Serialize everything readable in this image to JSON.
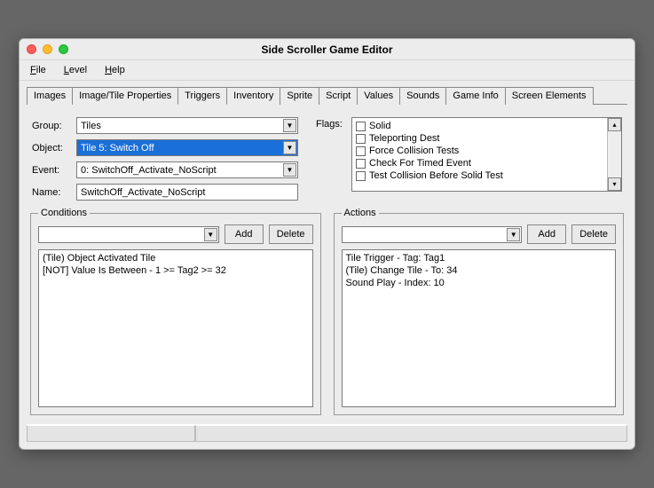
{
  "window": {
    "title": "Side Scroller Game Editor"
  },
  "menu": {
    "file": "File",
    "level": "Level",
    "help": "Help"
  },
  "tabs": [
    "Images",
    "Image/Tile Properties",
    "Triggers",
    "Inventory",
    "Sprite",
    "Script",
    "Values",
    "Sounds",
    "Game Info",
    "Screen Elements"
  ],
  "active_tab": "Triggers",
  "labels": {
    "group": "Group:",
    "object": "Object:",
    "event": "Event:",
    "name": "Name:",
    "flags": "Flags:",
    "conditions": "Conditions",
    "actions": "Actions",
    "add": "Add",
    "delete": "Delete"
  },
  "fields": {
    "group": "Tiles",
    "object": "Tile 5: Switch Off",
    "event": "0: SwitchOff_Activate_NoScript",
    "name": "SwitchOff_Activate_NoScript"
  },
  "flags": [
    "Solid",
    "Teleporting Dest",
    "Force Collision Tests",
    "Check For Timed Event",
    "Test Collision Before Solid Test"
  ],
  "conditions_selected": "",
  "conditions": [
    "(Tile) Object Activated Tile",
    "[NOT] Value Is Between - 1 >= Tag2 >= 32"
  ],
  "actions_selected": "",
  "actions": [
    "Tile Trigger - Tag: Tag1",
    "(Tile) Change Tile - To: 34",
    "Sound Play - Index: 10"
  ]
}
